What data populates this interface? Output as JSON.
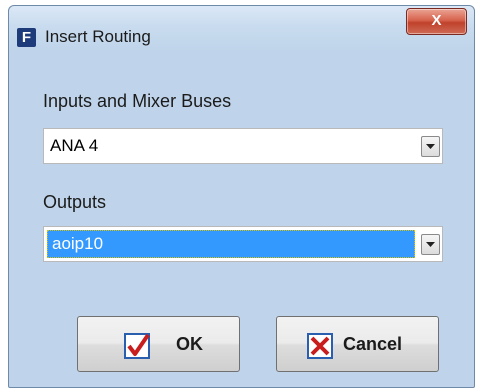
{
  "window": {
    "app_icon_letter": "F",
    "title": "Insert Routing",
    "close_glyph": "X"
  },
  "inputs": {
    "label": "Inputs and Mixer Buses",
    "selected_value": "ANA 4"
  },
  "outputs": {
    "label": "Outputs",
    "selected_value": "aoip10"
  },
  "buttons": {
    "ok_label": "OK",
    "cancel_label": "Cancel"
  },
  "colors": {
    "selection": "#3399ff",
    "close_button": "#c8432f",
    "ok_check": "#c81e1e",
    "cancel_x": "#c81e1e",
    "icon_frame": "#2a5fb0"
  },
  "icons": {
    "app": "app-f-icon",
    "close": "close-icon",
    "dropdown": "chevron-down-icon",
    "ok": "checkmark-icon",
    "cancel": "x-mark-icon"
  }
}
